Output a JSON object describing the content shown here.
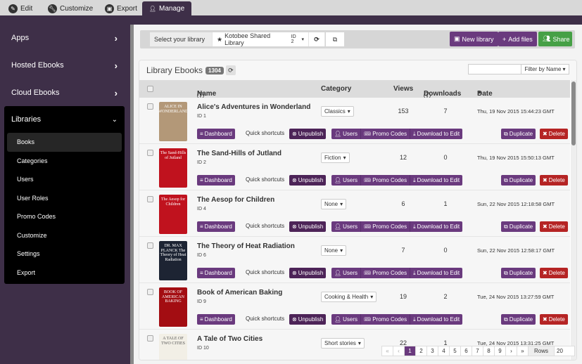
{
  "top_tabs": [
    {
      "label": "Edit",
      "icon": "pencil-icon"
    },
    {
      "label": "Customize",
      "icon": "wrench-icon"
    },
    {
      "label": "Export",
      "icon": "export-icon"
    },
    {
      "label": "Manage",
      "icon": "user-icon",
      "active": true
    }
  ],
  "sidebar": {
    "items": [
      {
        "label": "Apps"
      },
      {
        "label": "Hosted Ebooks"
      },
      {
        "label": "Cloud Ebooks"
      }
    ],
    "libraries": {
      "label": "Libraries",
      "subitems": [
        "Books",
        "Categories",
        "Users",
        "User Roles",
        "Promo Codes",
        "Customize",
        "Settings",
        "Export"
      ],
      "active": "Books"
    }
  },
  "toolbar": {
    "select_label": "Select your library",
    "library_name": "Kotobee Shared Library",
    "library_id": "ID 2",
    "new_library": "New library",
    "add_files": "Add files",
    "share": "Share"
  },
  "panel": {
    "title": "Library Ebooks",
    "count": "1304",
    "filter_placeholder": "",
    "filter_label": "Filter by Name"
  },
  "columns": {
    "name": "Name",
    "category": "Category",
    "views": "Views",
    "downloads": "Downloads",
    "date": "Date"
  },
  "row_buttons": {
    "dashboard": "Dashboard",
    "quick_shortcuts": "Quick shortcuts",
    "unpublish": "Unpublish",
    "users": "Users",
    "promo_codes": "Promo Codes",
    "download": "Download to Edit",
    "duplicate": "Duplicate",
    "delete": "Delete"
  },
  "books": [
    {
      "title": "Alice's Adventures in Wonderland",
      "id": "ID 1",
      "category": "Classics",
      "views": "153",
      "downloads": "7",
      "date": "Thu, 19 Nov 2015 15:44:23 GMT",
      "cover_text": "ALICE IN WONDERLAND",
      "cover_color": "#b39878"
    },
    {
      "title": "The Sand-Hills of Jutland",
      "id": "ID 2",
      "category": "Fiction",
      "views": "12",
      "downloads": "0",
      "date": "Thu, 19 Nov 2015 15:50:13 GMT",
      "cover_text": "The Sand-Hills of Jutland",
      "cover_color": "#c0121e"
    },
    {
      "title": "The Aesop for Children",
      "id": "ID 4",
      "category": "None",
      "views": "6",
      "downloads": "1",
      "date": "Sun, 22 Nov 2015 12:18:58 GMT",
      "cover_text": "The Aesop for Children",
      "cover_color": "#c0121e"
    },
    {
      "title": "The Theory of Heat Radiation",
      "id": "ID 6",
      "category": "None",
      "views": "7",
      "downloads": "0",
      "date": "Sun, 22 Nov 2015 12:58:17 GMT",
      "cover_text": "DR. MAX PLANCK The Theory of Heat Radiation",
      "cover_color": "#1d2433"
    },
    {
      "title": "Book of American Baking",
      "id": "ID 9",
      "category": "Cooking & Health",
      "views": "19",
      "downloads": "2",
      "date": "Tue, 24 Nov 2015 13:27:59 GMT",
      "cover_text": "BOOK OF AMERICAN BAKING",
      "cover_color": "#a30d12"
    },
    {
      "title": "A Tale of Two Cities",
      "id": "ID 10",
      "category": "Short stories",
      "views": "22",
      "downloads": "1",
      "date": "Tue, 24 Nov 2015 13:31:25 GMT",
      "cover_text": "A TALE OF TWO CITIES",
      "cover_color": "#f2efe6"
    }
  ],
  "pagination": {
    "first": "«",
    "prev": "‹",
    "pages": [
      "1",
      "2",
      "3",
      "4",
      "5",
      "6",
      "7",
      "8",
      "9"
    ],
    "current": "1",
    "next": "›",
    "last": "»",
    "rows_label": "Rows",
    "rows_value": "20"
  }
}
